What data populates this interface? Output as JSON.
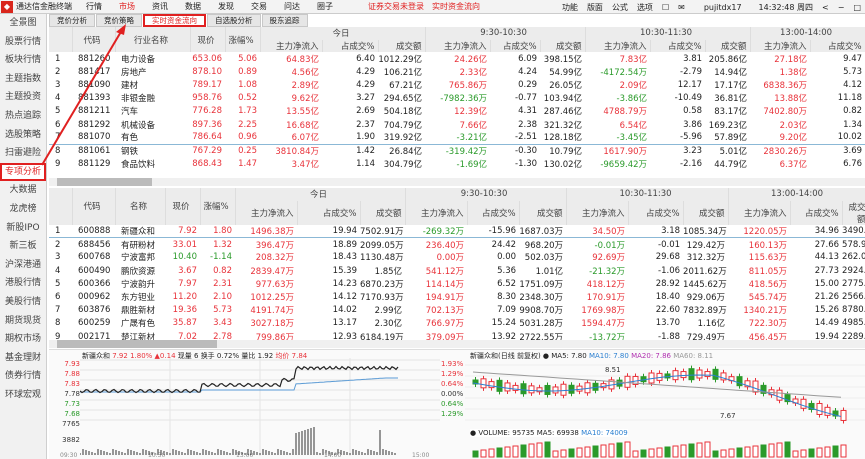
{
  "topbar": {
    "app_title": "通达信金融终端",
    "menu": [
      "行情",
      "市场",
      "资讯",
      "数据",
      "发现",
      "交易",
      "问达",
      "圈子"
    ],
    "active_menu": 1,
    "alert1": "证券交易未登录",
    "alert2": "实时资金流向",
    "tools": [
      "功能",
      "版面",
      "公式",
      "选项"
    ],
    "user": "pujitdx17",
    "time": "14:32:48 周四",
    "window_controls": [
      "<",
      "−",
      "□"
    ]
  },
  "sidebar": {
    "items": [
      "全景图",
      "股票行情",
      "板块行情",
      "主题指数",
      "主题投资",
      "热点追踪",
      "选股策略",
      "扫雷避险",
      "专项分析",
      "大数据",
      "龙虎榜",
      "新股IPO",
      "新三板",
      "沪深港通",
      "港股行情",
      "美股行情",
      "期货现货",
      "期权市场",
      "基金理财",
      "债券行情",
      "环球宏观"
    ],
    "selected": 8
  },
  "tabs": {
    "items": [
      "竞价分析",
      "竞价策略",
      "实时资金流向",
      "自选股分析",
      "股东追踪"
    ],
    "selected": 2
  },
  "groups": [
    "今日",
    "9:30-10:30",
    "10:30-11:30",
    "13:00-14:00"
  ],
  "sub_cols": [
    "主力净流入",
    "占成交%",
    "成交额"
  ],
  "sector_table": {
    "columns": [
      "",
      "代码",
      "行业名称",
      "现价",
      "涨幅%"
    ],
    "rows": [
      [
        "1",
        "881260",
        "电力设备",
        "653.06",
        "5.06",
        "64.83亿",
        "6.40",
        "1012.29亿",
        "24.26亿",
        "6.09",
        "398.15亿",
        "7.83亿",
        "3.81",
        "205.86亿",
        "27.18亿",
        "9.47"
      ],
      [
        "2",
        "881417",
        "房地产",
        "878.10",
        "0.89",
        "4.56亿",
        "4.29",
        "106.21亿",
        "2.33亿",
        "4.24",
        "54.99亿",
        "-4172.54万",
        "-2.79",
        "14.94亿",
        "1.38亿",
        "5.73"
      ],
      [
        "3",
        "881090",
        "建材",
        "789.17",
        "1.08",
        "2.89亿",
        "4.29",
        "67.21亿",
        "765.86万",
        "0.29",
        "26.05亿",
        "2.09亿",
        "12.17",
        "17.17亿",
        "6838.36万",
        "4.12"
      ],
      [
        "4",
        "881393",
        "非银金融",
        "958.76",
        "0.52",
        "9.62亿",
        "3.27",
        "294.65亿",
        "-7982.36万",
        "-0.77",
        "103.94亿",
        "-3.86亿",
        "-10.49",
        "36.81亿",
        "13.88亿",
        "11.18"
      ],
      [
        "5",
        "881211",
        "汽车",
        "776.28",
        "1.73",
        "13.55亿",
        "2.69",
        "504.18亿",
        "12.39亿",
        "4.31",
        "287.46亿",
        "4788.79万",
        "0.58",
        "83.17亿",
        "7402.80万",
        "0.82"
      ],
      [
        "6",
        "881292",
        "机械设备",
        "897.36",
        "2.25",
        "16.68亿",
        "2.37",
        "704.79亿",
        "7.66亿",
        "2.38",
        "321.32亿",
        "6.54亿",
        "3.86",
        "169.23亿",
        "2.03亿",
        "1.34"
      ],
      [
        "7",
        "881070",
        "有色",
        "786.64",
        "0.96",
        "6.07亿",
        "1.90",
        "319.92亿",
        "-3.21亿",
        "-2.51",
        "128.18亿",
        "-3.45亿",
        "-5.96",
        "57.89亿",
        "9.20亿",
        "10.02"
      ],
      [
        "8",
        "881061",
        "钢铁",
        "767.29",
        "0.25",
        "3810.84万",
        "1.42",
        "26.84亿",
        "-319.42万",
        "-0.30",
        "10.79亿",
        "1617.90万",
        "3.23",
        "5.01亿",
        "2830.26万",
        "3.69"
      ],
      [
        "9",
        "881129",
        "食品饮料",
        "868.43",
        "1.47",
        "3.47亿",
        "1.14",
        "304.79亿",
        "-1.69亿",
        "-1.30",
        "130.02亿",
        "-9659.42万",
        "-2.16",
        "44.79亿",
        "6.37亿",
        "6.76"
      ]
    ]
  },
  "stock_table": {
    "columns": [
      "",
      "代码",
      "名称",
      "现价",
      "涨幅%"
    ],
    "rows": [
      [
        "1",
        "600888",
        "新疆众和",
        "7.92",
        "1.80",
        "1496.38万",
        "19.94",
        "7502.91万",
        "-269.32万",
        "-15.96",
        "1687.03万",
        "34.50万",
        "3.18",
        "1085.34万",
        "1220.05万",
        "34.96",
        "3490.2"
      ],
      [
        "2",
        "688456",
        "有研粉材",
        "33.01",
        "1.32",
        "396.47万",
        "18.89",
        "2099.05万",
        "236.40万",
        "24.42",
        "968.20万",
        "-0.01万",
        "-0.01",
        "129.42万",
        "160.13万",
        "27.66",
        "578.9"
      ],
      [
        "3",
        "600768",
        "宁波富邦",
        "10.40",
        "-1.14",
        "208.32万",
        "18.43",
        "1130.48万",
        "0.00万",
        "0.00",
        "502.03万",
        "92.69万",
        "29.68",
        "312.32万",
        "115.63万",
        "44.13",
        "262.0"
      ],
      [
        "4",
        "600490",
        "鹏欣资源",
        "3.67",
        "0.82",
        "2839.47万",
        "15.39",
        "1.85亿",
        "541.12万",
        "5.36",
        "1.01亿",
        "-21.32万",
        "-1.06",
        "2011.62万",
        "811.05万",
        "27.73",
        "2924.6"
      ],
      [
        "5",
        "600366",
        "宁波韵升",
        "7.97",
        "2.31",
        "977.63万",
        "14.23",
        "6870.23万",
        "114.14万",
        "6.52",
        "1751.09万",
        "418.12万",
        "28.92",
        "1445.62万",
        "418.56万",
        "15.00",
        "2775.7"
      ],
      [
        "6",
        "000962",
        "东方钽业",
        "11.20",
        "2.10",
        "1012.25万",
        "14.12",
        "7170.93万",
        "194.91万",
        "8.30",
        "2348.30万",
        "170.91万",
        "18.40",
        "929.06万",
        "545.74万",
        "21.26",
        "2566.7"
      ],
      [
        "7",
        "603876",
        "鼎胜新材",
        "19.36",
        "5.73",
        "4191.74万",
        "14.02",
        "2.99亿",
        "702.13万",
        "7.09",
        "9908.70万",
        "1769.98万",
        "22.60",
        "7832.89万",
        "1340.21万",
        "15.26",
        "8780.7"
      ],
      [
        "8",
        "600259",
        "广晟有色",
        "35.87",
        "3.43",
        "3027.18万",
        "13.17",
        "2.30亿",
        "766.97万",
        "15.24",
        "5031.28万",
        "1594.47万",
        "13.70",
        "1.16亿",
        "722.30万",
        "14.49",
        "4985.0"
      ],
      [
        "9",
        "002171",
        "楚江新材",
        "7.02",
        "2.78",
        "799.86万",
        "12.93",
        "6184.19万",
        "379.09万",
        "13.92",
        "2722.55万",
        "-13.72万",
        "-1.88",
        "729.49万",
        "456.45万",
        "19.94",
        "2289.3"
      ]
    ]
  },
  "intraday": {
    "name": "新疆众和",
    "price": "7.92",
    "pct": "1.80%",
    "change": "▲0.14",
    "vol_label": "现量 6",
    "turnover": "换手 0.72%",
    "ratio": "量比 1.92",
    "avg": "均价 7.84",
    "yticks_left": [
      "7.93",
      "7.88",
      "7.83",
      "7.78",
      "7.73",
      "7.68"
    ],
    "yticks_right": [
      "1.93%",
      "1.29%",
      "0.64%",
      "0.00%",
      "0.64%",
      "1.29%"
    ],
    "vol_ticks": [
      "7765",
      "3882"
    ],
    "xticks": [
      "09:30",
      "10:30",
      "13:00",
      "14:00",
      "15:00"
    ]
  },
  "kline": {
    "title": "新疆众和(日线 前复权)",
    "ma5": "MA5: 7.80",
    "ma10": "MA10: 7.80",
    "ma20": "MA20: 7.86",
    "ma60": "MA60: 8.11",
    "high_mark": "8.51",
    "low_mark": "7.67",
    "volume": "VOLUME: 95735",
    "vma5": "MA5: 69938",
    "vma10": "MA10: 74009"
  },
  "colors": {
    "up": "#e8323a",
    "down": "#2a9a2a",
    "accent": "#e02020"
  }
}
